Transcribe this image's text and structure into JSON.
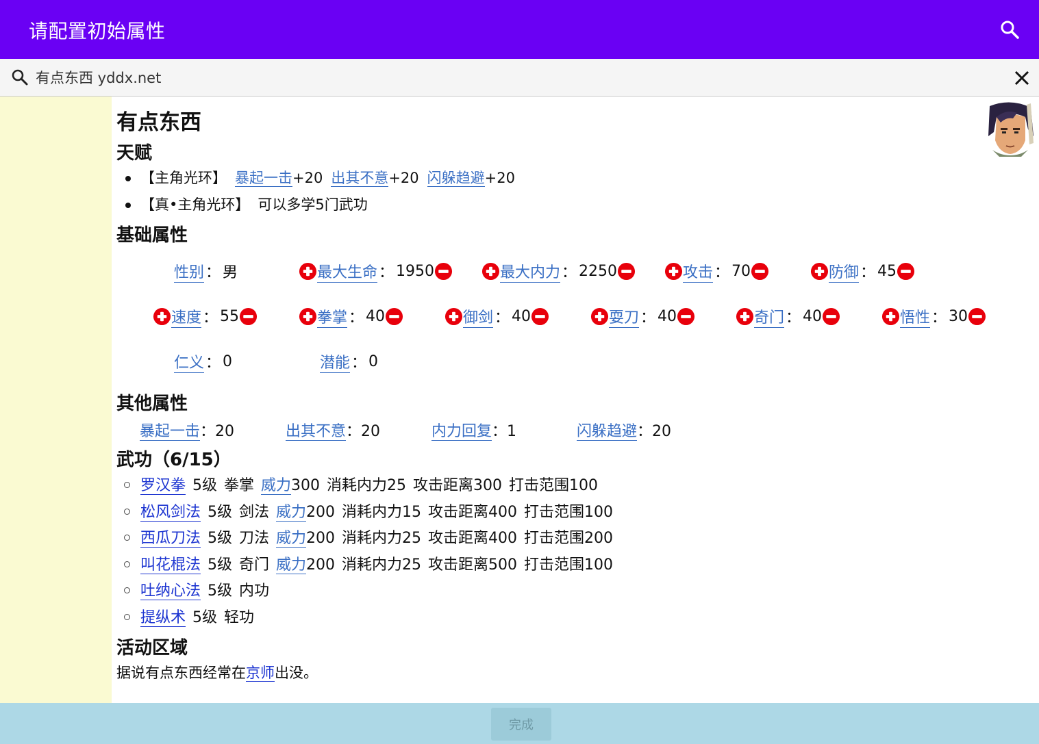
{
  "appbar": {
    "title": "请配置初始属性"
  },
  "search": {
    "value": "有点东西 yddx.net"
  },
  "character": {
    "name": "有点东西"
  },
  "talents": {
    "heading": "天赋",
    "row1": {
      "label": "【主角光环】",
      "items": [
        {
          "name": "暴起一击",
          "bonus": "+20"
        },
        {
          "name": "出其不意",
          "bonus": "+20"
        },
        {
          "name": "闪躲趋避",
          "bonus": "+20"
        }
      ]
    },
    "row2": {
      "label": "【真•主角光环】",
      "desc": "可以多学5门武功"
    }
  },
  "basic": {
    "heading": "基础属性",
    "colon": "：",
    "gender": {
      "name": "性别",
      "value": "男"
    },
    "max_hp": {
      "name": "最大生命",
      "value": "1950"
    },
    "max_mp": {
      "name": "最大内力",
      "value": "2250"
    },
    "attack": {
      "name": "攻击",
      "value": "70"
    },
    "defense": {
      "name": "防御",
      "value": "45"
    },
    "speed": {
      "name": "速度",
      "value": "55"
    },
    "fist": {
      "name": "拳掌",
      "value": "40"
    },
    "sword": {
      "name": "御剑",
      "value": "40"
    },
    "blade": {
      "name": "耍刀",
      "value": "40"
    },
    "special": {
      "name": "奇门",
      "value": "40"
    },
    "wisdom": {
      "name": "悟性",
      "value": "30"
    },
    "virtue": {
      "name": "仁义",
      "value": "0"
    },
    "potential": {
      "name": "潜能",
      "value": "0"
    }
  },
  "other": {
    "heading": "其他属性",
    "crit": {
      "name": "暴起一击",
      "value": "20"
    },
    "surprise": {
      "name": "出其不意",
      "value": "20"
    },
    "regen": {
      "name": "内力回复",
      "value": "1"
    },
    "dodge": {
      "name": "闪躲趋避",
      "value": "20"
    }
  },
  "skills": {
    "heading": "武功（6/15）",
    "power_label": "威力",
    "items": [
      {
        "name": "罗汉拳",
        "level": "5级",
        "type": "拳掌",
        "power": "300",
        "cost": "消耗内力25",
        "range": "攻击距离300",
        "area": "打击范围100"
      },
      {
        "name": "松风剑法",
        "level": "5级",
        "type": "剑法",
        "power": "200",
        "cost": "消耗内力15",
        "range": "攻击距离400",
        "area": "打击范围100"
      },
      {
        "name": "西瓜刀法",
        "level": "5级",
        "type": "刀法",
        "power": "200",
        "cost": "消耗内力25",
        "range": "攻击距离400",
        "area": "打击范围200"
      },
      {
        "name": "叫花棍法",
        "level": "5级",
        "type": "奇门",
        "power": "200",
        "cost": "消耗内力25",
        "range": "攻击距离500",
        "area": "打击范围100"
      },
      {
        "name": "吐纳心法",
        "level": "5级",
        "type": "内功"
      },
      {
        "name": "提纵术",
        "level": "5级",
        "type": "轻功"
      }
    ]
  },
  "activity": {
    "heading": "活动区域",
    "prefix": "据说有点东西经常在",
    "place": "京师",
    "suffix": "出没。"
  },
  "footer": {
    "done_label": "完成"
  },
  "colors": {
    "appbar": "#6a00f4",
    "sidebar": "#fafad2",
    "footer": "#add8e6",
    "link": "#3a6fc4",
    "skill_link": "#1d35d1",
    "plus_minus": "#e8000b"
  }
}
